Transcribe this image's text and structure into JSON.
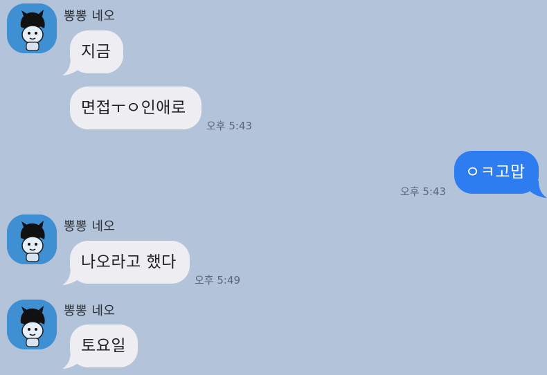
{
  "colors": {
    "background": "#b3c3d9",
    "incoming_bubble": "#eeeef2",
    "outgoing_bubble": "#2d7df1",
    "avatar_bg": "#3f8fd3"
  },
  "messages": [
    {
      "sender": "뽕뽕 네오",
      "bubbles": [
        "지금",
        "면접ㅜㅇ인애로"
      ],
      "time": "오후 5:43"
    },
    {
      "sender": "me",
      "bubbles": [
        "ㅇㅋ고맙"
      ],
      "time": "오후 5:43"
    },
    {
      "sender": "뽕뽕 네오",
      "bubbles": [
        "나오라고 했다"
      ],
      "time": "오후 5:49"
    },
    {
      "sender": "뽕뽕 네오",
      "bubbles": [
        "토요일"
      ],
      "time": ""
    }
  ],
  "icons": {
    "avatar": "cartoon-character-avatar-icon"
  }
}
